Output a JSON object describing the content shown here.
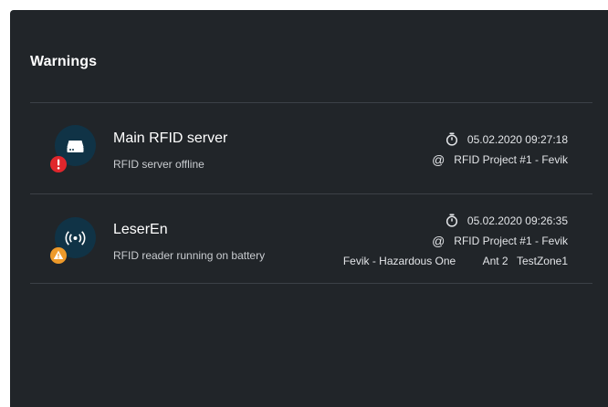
{
  "panel": {
    "title": "Warnings"
  },
  "warnings": [
    {
      "title": "Main RFID server",
      "subtitle": "RFID server offline",
      "icon": "server-icon",
      "badge": "error-badge-icon",
      "badge_color": "#e0262c",
      "timestamp": "05.02.2020 09:27:18",
      "project": "RFID Project #1 - Fevik"
    },
    {
      "title": "LeserEn",
      "subtitle": "RFID reader running on battery",
      "icon": "rfid-reader-icon",
      "badge": "warning-badge-icon",
      "badge_color": "#ee9a2a",
      "timestamp": "05.02.2020 09:26:35",
      "project": "RFID Project #1 - Fevik",
      "location": "Fevik - Hazardous One",
      "antenna": "Ant 2",
      "zone": "TestZone1"
    }
  ],
  "colors": {
    "panel_bg": "#212529",
    "avatar_bg": "#103346",
    "divider": "#3c4147"
  }
}
